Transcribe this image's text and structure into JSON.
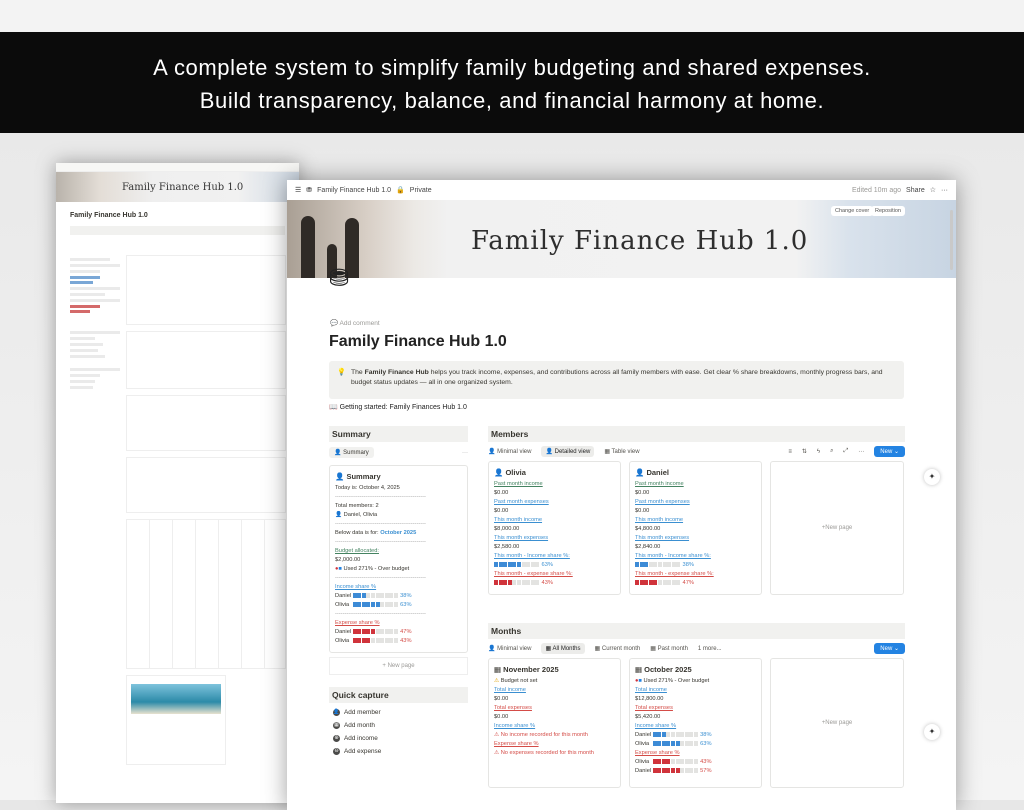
{
  "banner": {
    "line1": "A complete system to simplify family budgeting and shared expenses.",
    "line2": "Build transparency, balance, and financial harmony at home."
  },
  "thumbnail": {
    "cover_title": "Family Finance Hub 1.0",
    "page_title": "Family Finance Hub 1.0"
  },
  "window": {
    "breadcrumb": "Family Finance Hub 1.0",
    "privacy": "Private",
    "edited": "Edited 10m ago",
    "share": "Share",
    "cover_title": "Family Finance Hub 1.0",
    "change_cover": "Change cover",
    "reposition": "Reposition",
    "add_comment": "Add comment",
    "page_title": "Family Finance Hub 1.0",
    "callout": {
      "bold": "Family Finance Hub",
      "pre": "The ",
      "text": " helps you track income, expenses, and contributions across all family members with ease. Get clear % share breakdowns, monthly progress bars, and budget status updates — all in one organized system."
    },
    "getting_started": "Getting started: Family Finances Hub 1.0"
  },
  "summary": {
    "heading": "Summary",
    "chip": "Summary",
    "card_title": "Summary",
    "today": "Today is: October 4, 2025",
    "divider": "------------------------------------------------",
    "members_label": "Total members: 2",
    "members": "Daniel, Olivia",
    "below": "Below data is for: ",
    "below_month": "October 2025",
    "budget_label": "Budget allocated:",
    "budget_value": "$2,000.00",
    "used": "Used 271% - Over budget",
    "income_share_label": "Income share %",
    "income_share": [
      {
        "name": "Daniel",
        "pct": "38%",
        "filled": 3
      },
      {
        "name": "Olivia",
        "pct": "63%",
        "filled": 6
      }
    ],
    "expense_share_label": "Expense share %",
    "expense_share": [
      {
        "name": "Daniel",
        "pct": "47%",
        "filled": 5
      },
      {
        "name": "Olivia",
        "pct": "43%",
        "filled": 4
      }
    ],
    "new_page": "New page"
  },
  "quick_capture": {
    "heading": "Quick capture",
    "items": [
      "Add member",
      "Add month",
      "Add income",
      "Add expense"
    ]
  },
  "members": {
    "heading": "Members",
    "tabs": [
      "Minimal view",
      "Detailed view",
      "Table view"
    ],
    "new_button": "New",
    "new_page": "New page",
    "labels": {
      "past_income": "Past month income",
      "past_expenses": "Past month expenses",
      "this_income": "This month income",
      "this_expenses": "This month expenses",
      "income_share": "This month - Income share %:",
      "expense_share": "This month - expense share %:"
    },
    "cards": [
      {
        "name": "Olivia",
        "past_income": "$0.00",
        "past_expenses": "$0.00",
        "this_income": "$8,000.00",
        "this_expenses": "$2,580.00",
        "income_pct": "63%",
        "income_filled": 6,
        "expense_pct": "43%",
        "expense_filled": 4
      },
      {
        "name": "Daniel",
        "past_income": "$0.00",
        "past_expenses": "$0.00",
        "this_income": "$4,800.00",
        "this_expenses": "$2,840.00",
        "income_pct": "38%",
        "income_filled": 3,
        "expense_pct": "47%",
        "expense_filled": 5
      }
    ]
  },
  "months": {
    "heading": "Months",
    "tabs": [
      "Minimal view",
      "All Months",
      "Current month",
      "Past month",
      "1 more..."
    ],
    "new_button": "New",
    "new_page": "New page",
    "cards": [
      {
        "name": "November 2025",
        "status": "Budget not set",
        "total_income_label": "Total income",
        "total_income": "$0.00",
        "total_expenses_label": "Total expenses",
        "total_expenses": "$0.00",
        "income_share_label": "Income share %",
        "income_note": "No income recorded for this month",
        "expense_share_label": "Expense share %",
        "expense_note": "No expenses recorded for this month"
      },
      {
        "name": "October 2025",
        "status": "Used 271% - Over budget",
        "total_income_label": "Total income",
        "total_income": "$12,800.00",
        "total_expenses_label": "Total expenses",
        "total_expenses": "$5,420.00",
        "income_share_label": "Income share %",
        "income_rows": [
          {
            "name": "Daniel",
            "pct": "38%",
            "filled": 3
          },
          {
            "name": "Olivia",
            "pct": "63%",
            "filled": 6
          }
        ],
        "expense_share_label": "Expense share %",
        "expense_rows": [
          {
            "name": "Olivia",
            "pct": "43%",
            "filled": 4
          },
          {
            "name": "Daniel",
            "pct": "57%",
            "filled": 6
          }
        ]
      }
    ]
  }
}
